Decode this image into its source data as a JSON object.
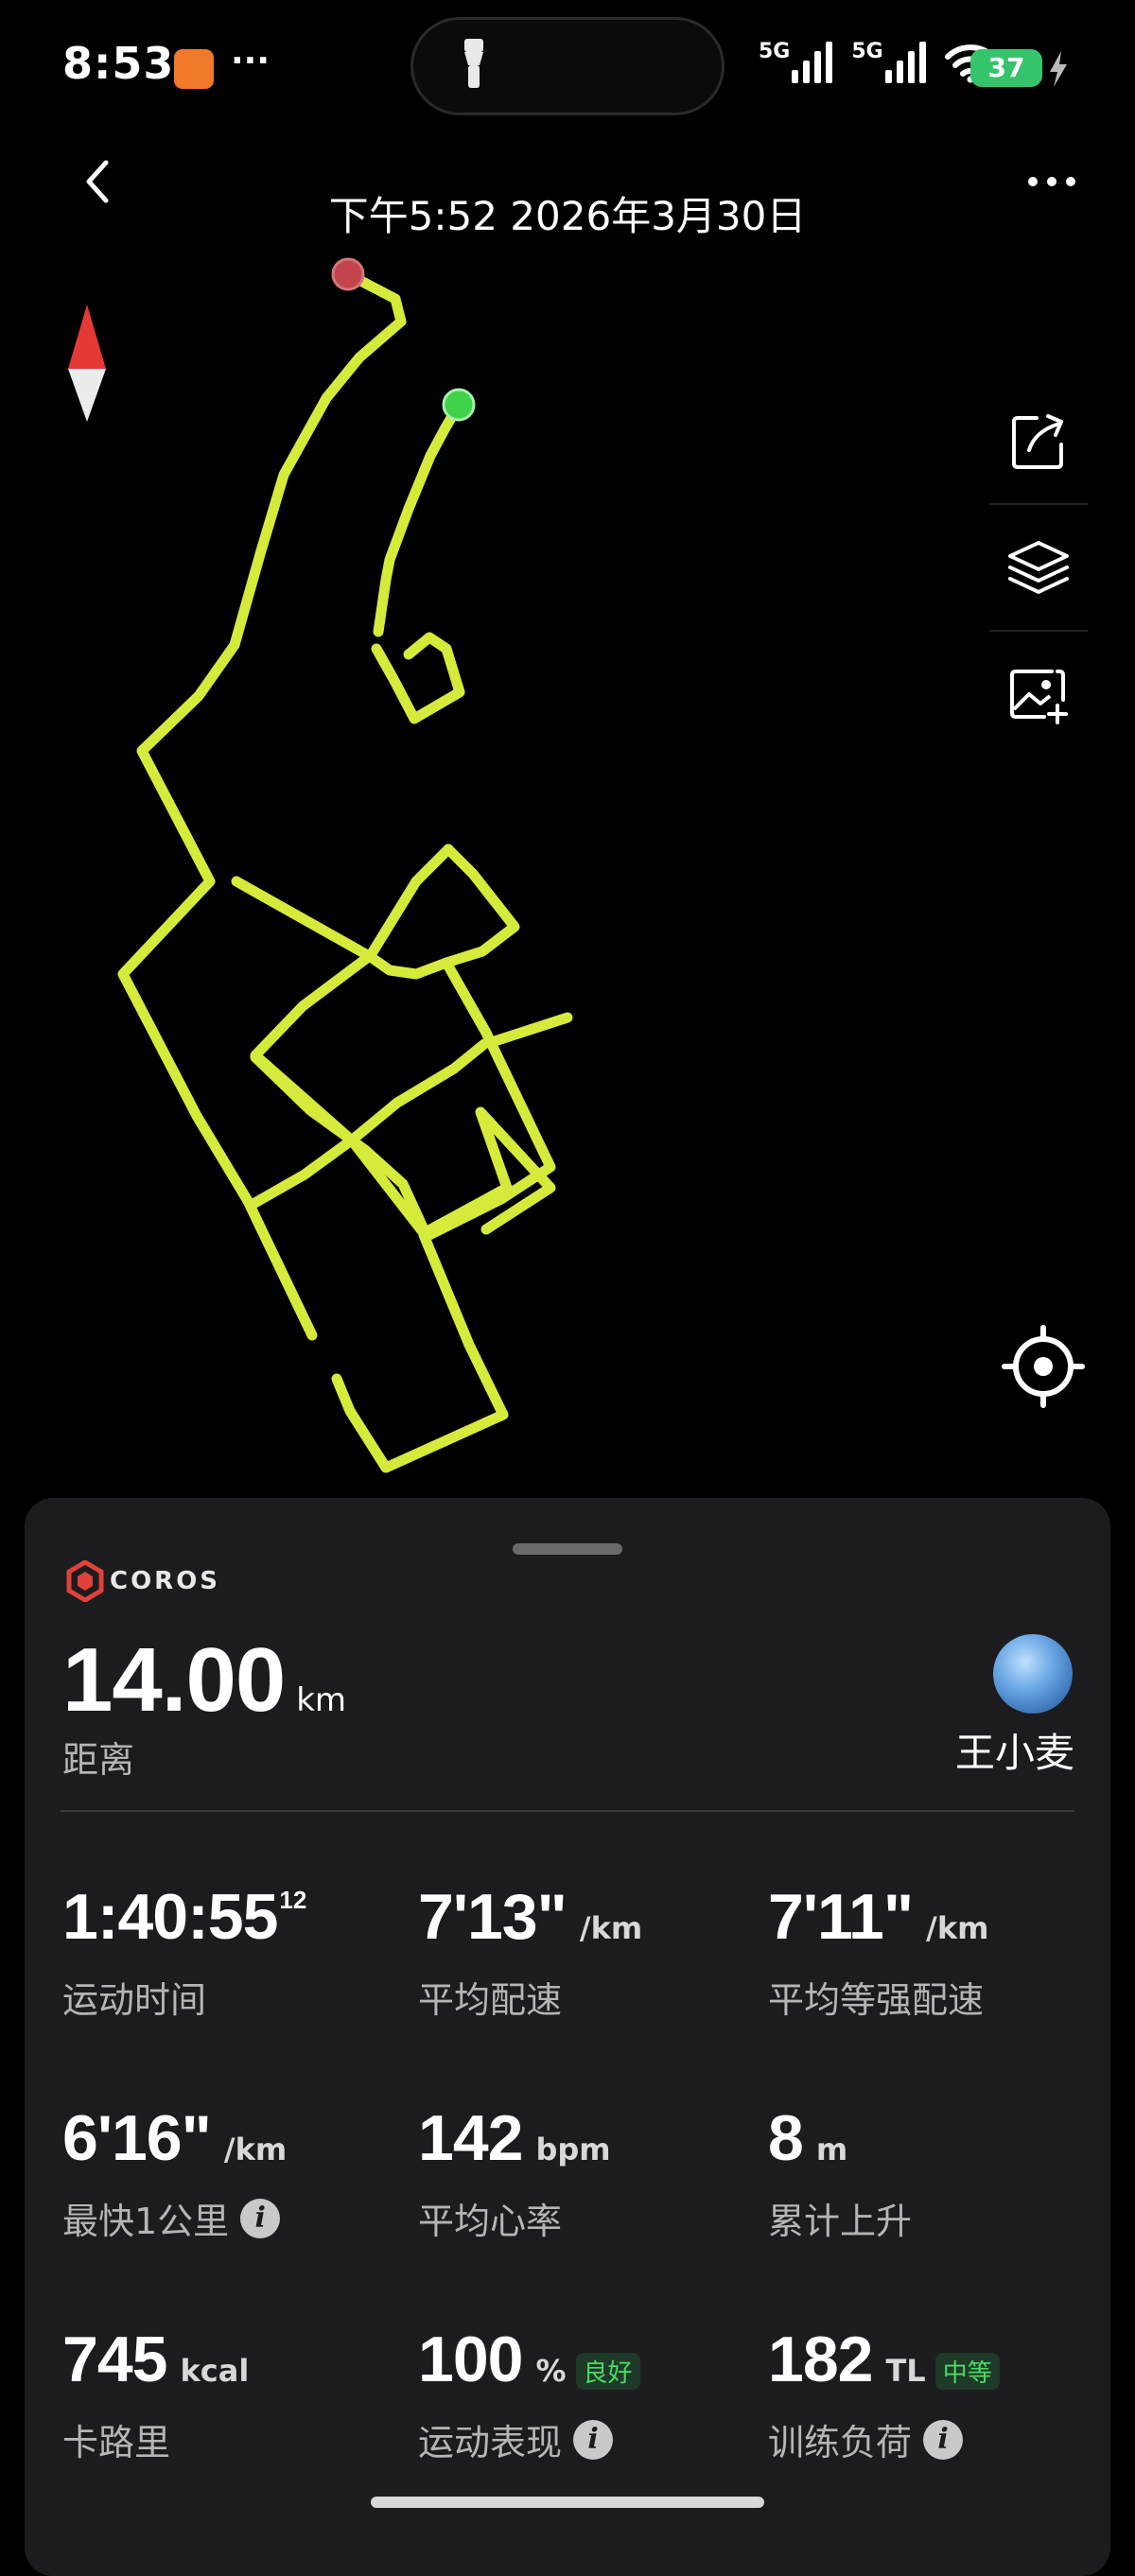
{
  "status_bar": {
    "time": "8:53",
    "dots": "···",
    "signal1": "5G",
    "signal2": "5G",
    "battery": "37",
    "icons": [
      "app-notification-icon",
      "flashlight-icon",
      "signal-icon",
      "wifi-icon",
      "battery-icon",
      "charging-icon"
    ]
  },
  "header": {
    "title": "下午5:52 2026年3月30日",
    "back_icon": "chevron-left-icon",
    "more_icon": "more-icon"
  },
  "map": {
    "route_color": "#d6ea3b",
    "start_color": "#3fd24a",
    "end_color": "#c2454d",
    "tools": [
      "share-icon",
      "layers-icon",
      "add-image-icon"
    ],
    "locate_icon": "locate-icon",
    "compass_icon": "compass-icon"
  },
  "panel": {
    "brand": "COROS",
    "distance": {
      "value": "14.00",
      "unit": "km",
      "label": "距离"
    },
    "user": {
      "name": "王小麦"
    },
    "metrics": [
      {
        "value": "1:40:55",
        "sup": "12",
        "unit": "",
        "tag": "",
        "label": "运动时间",
        "info": false
      },
      {
        "value": "7'13\"",
        "sup": "",
        "unit": "/km",
        "tag": "",
        "label": "平均配速",
        "info": false
      },
      {
        "value": "7'11\"",
        "sup": "",
        "unit": "/km",
        "tag": "",
        "label": "平均等强配速",
        "info": false
      },
      {
        "value": "6'16\"",
        "sup": "",
        "unit": "/km",
        "tag": "",
        "label": "最快1公里",
        "info": true
      },
      {
        "value": "142",
        "sup": "",
        "unit": "bpm",
        "tag": "",
        "label": "平均心率",
        "info": false
      },
      {
        "value": "8",
        "sup": "",
        "unit": "m",
        "tag": "",
        "label": "累计上升",
        "info": false
      },
      {
        "value": "745",
        "sup": "",
        "unit": "kcal",
        "tag": "",
        "label": "卡路里",
        "info": false
      },
      {
        "value": "100",
        "sup": "",
        "unit": "%",
        "tag": "良好",
        "label": "运动表现",
        "info": true
      },
      {
        "value": "182",
        "sup": "",
        "unit": "TL",
        "tag": "中等",
        "label": "训练负荷",
        "info": true
      }
    ]
  }
}
